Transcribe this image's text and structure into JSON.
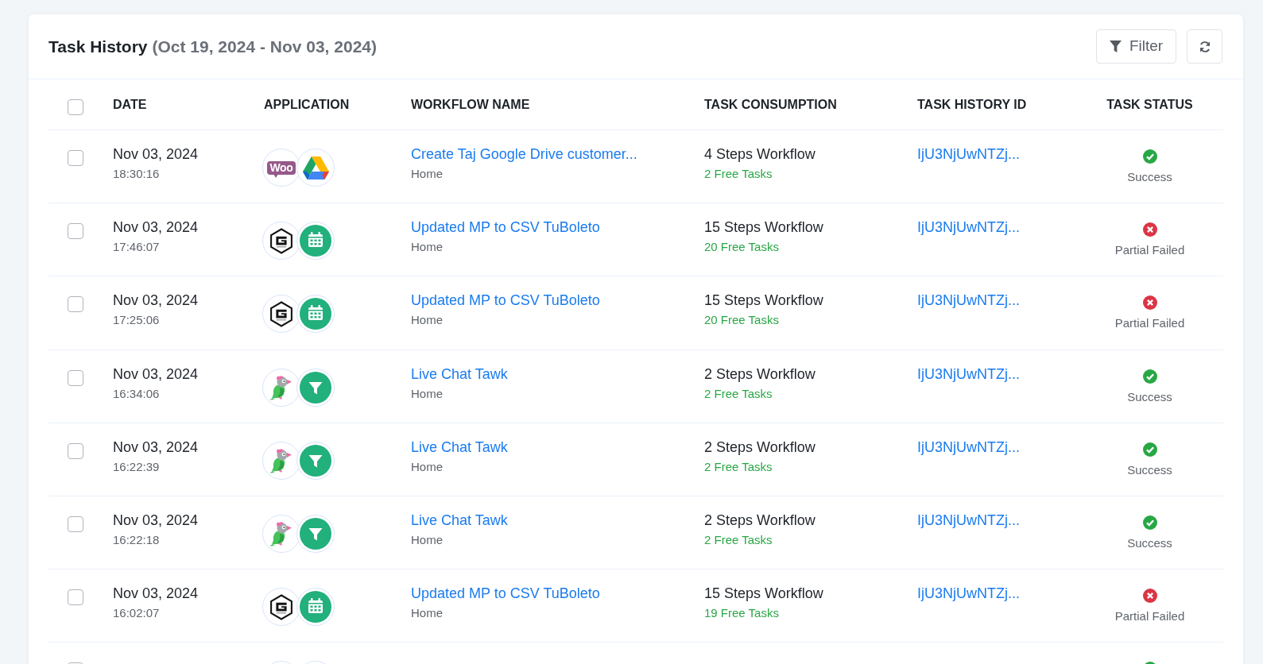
{
  "header": {
    "title": "Task History",
    "date_range": "(Oct 19, 2024 - Nov 03, 2024)",
    "buttons": [
      {
        "kind": "filter",
        "label": "Filter"
      },
      {
        "kind": "refresh"
      }
    ]
  },
  "table": {
    "select_all": {
      "checked": false
    },
    "columns": [
      "DATE",
      "APPLICATION",
      "WORKFLOW NAME",
      "TASK CONSUMPTION",
      "TASK HISTORY ID",
      "TASK STATUS"
    ],
    "rows": [
      {
        "checked": false,
        "date": "Nov 03, 2024",
        "time": "18:30:16",
        "apps": [
          {
            "kind": "woo",
            "text": "Woo"
          },
          {
            "kind": "triangle"
          }
        ],
        "workflow": "Create Taj Google Drive customer...",
        "folder": "Home",
        "steps": "4 Steps Workflow",
        "free_tasks": "2 Free Tasks",
        "task_history_id": "IjU3NjUwNTZj...",
        "status": {
          "kind": "success",
          "text": "Success"
        }
      },
      {
        "checked": false,
        "date": "Nov 03, 2024",
        "time": "17:46:07",
        "apps": [
          {
            "kind": "hexagon"
          },
          {
            "kind": "calendar"
          }
        ],
        "workflow": "Updated MP to CSV TuBoleto",
        "folder": "Home",
        "steps": "15 Steps Workflow",
        "free_tasks": "20 Free Tasks",
        "task_history_id": "IjU3NjUwNTZj...",
        "status": {
          "kind": "failed",
          "text": "Partial Failed"
        }
      },
      {
        "checked": false,
        "date": "Nov 03, 2024",
        "time": "17:25:06",
        "apps": [
          {
            "kind": "hexagon"
          },
          {
            "kind": "calendar"
          }
        ],
        "workflow": "Updated MP to CSV TuBoleto",
        "folder": "Home",
        "steps": "15 Steps Workflow",
        "free_tasks": "20 Free Tasks",
        "task_history_id": "IjU3NjUwNTZj...",
        "status": {
          "kind": "failed",
          "text": "Partial Failed"
        }
      },
      {
        "checked": false,
        "date": "Nov 03, 2024",
        "time": "16:34:06",
        "apps": [
          {
            "kind": "parrot"
          },
          {
            "kind": "funnel"
          }
        ],
        "workflow": "Live Chat Tawk",
        "folder": "Home",
        "steps": "2 Steps Workflow",
        "free_tasks": "2 Free Tasks",
        "task_history_id": "IjU3NjUwNTZj...",
        "status": {
          "kind": "success",
          "text": "Success"
        }
      },
      {
        "checked": false,
        "date": "Nov 03, 2024",
        "time": "16:22:39",
        "apps": [
          {
            "kind": "parrot"
          },
          {
            "kind": "funnel"
          }
        ],
        "workflow": "Live Chat Tawk",
        "folder": "Home",
        "steps": "2 Steps Workflow",
        "free_tasks": "2 Free Tasks",
        "task_history_id": "IjU3NjUwNTZj...",
        "status": {
          "kind": "success",
          "text": "Success"
        }
      },
      {
        "checked": false,
        "date": "Nov 03, 2024",
        "time": "16:22:18",
        "apps": [
          {
            "kind": "parrot"
          },
          {
            "kind": "funnel"
          }
        ],
        "workflow": "Live Chat Tawk",
        "folder": "Home",
        "steps": "2 Steps Workflow",
        "free_tasks": "2 Free Tasks",
        "task_history_id": "IjU3NjUwNTZj...",
        "status": {
          "kind": "success",
          "text": "Success"
        }
      },
      {
        "checked": false,
        "date": "Nov 03, 2024",
        "time": "16:02:07",
        "apps": [
          {
            "kind": "hexagon"
          },
          {
            "kind": "calendar"
          }
        ],
        "workflow": "Updated MP to CSV TuBoleto",
        "folder": "Home",
        "steps": "15 Steps Workflow",
        "free_tasks": "19 Free Tasks",
        "task_history_id": "IjU3NjUwNTZj...",
        "status": {
          "kind": "failed",
          "text": "Partial Failed"
        }
      },
      {
        "checked": false,
        "apps": [
          {
            "kind": "blank"
          },
          {
            "kind": "blank"
          }
        ],
        "status": {
          "kind": "success"
        }
      }
    ]
  }
}
